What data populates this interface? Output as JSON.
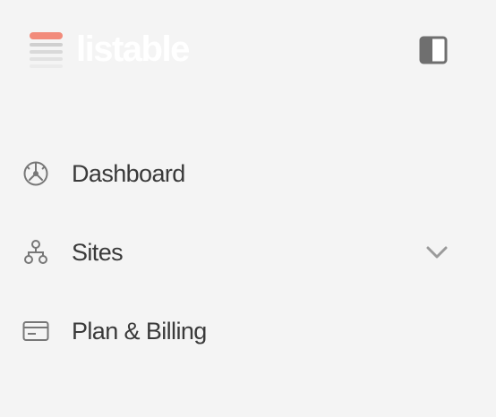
{
  "brand": {
    "name": "listable",
    "logo_icon": "stacked-bars-logo",
    "accent_color": "#f28b7b",
    "name_color": "#ffffff"
  },
  "header": {
    "toggle_icon": "sidebar-toggle-icon"
  },
  "nav": {
    "items": [
      {
        "label": "Dashboard",
        "icon": "dashboard-gauge-icon",
        "has_children": false
      },
      {
        "label": "Sites",
        "icon": "sitemap-icon",
        "has_children": true
      },
      {
        "label": "Plan & Billing",
        "icon": "credit-card-icon",
        "has_children": false
      }
    ]
  },
  "colors": {
    "background": "#f4f4f4",
    "text": "#3a3a3a",
    "icon": "#777777",
    "chevron": "#9a9a9a"
  }
}
